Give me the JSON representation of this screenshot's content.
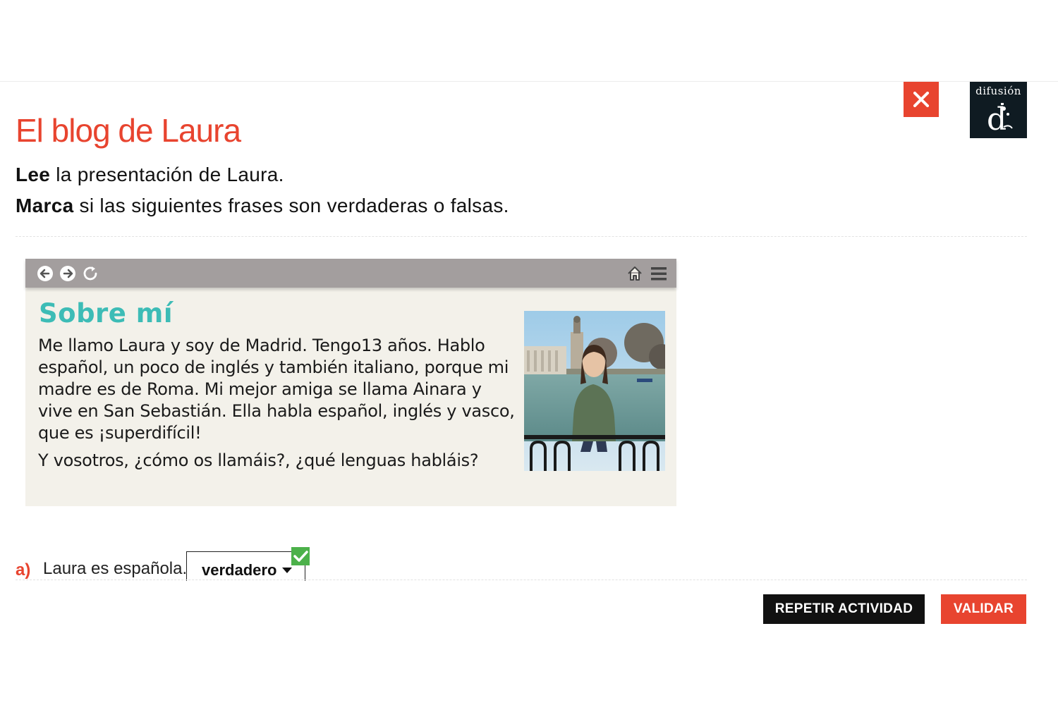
{
  "header": {
    "logo_text": "difusión",
    "logo_mark": "d"
  },
  "activity": {
    "title": "El blog de Laura",
    "instruction_1_bold": "Lee",
    "instruction_1_rest": " la presentación de Laura.",
    "instruction_2_bold": "Marca",
    "instruction_2_rest": " si las siguientes frases son verdaderas o falsas."
  },
  "blog": {
    "heading": "Sobre mí",
    "paragraph": "Me llamo Laura y soy de Madrid. Tengo13 años. Hablo español, un poco de inglés y también italiano, porque mi madre es de Roma. Mi mejor amiga se llama Ainara y vive en San Sebastián. Ella habla español, inglés y vasco, que es ¡superdifícil!",
    "question": "Y vosotros, ¿cómo os llamáis?, ¿qué lenguas habláis?"
  },
  "questions": [
    {
      "letter": "a)",
      "text": "Laura es española.",
      "selected": "verdadero"
    }
  ],
  "buttons": {
    "repeat": "REPETIR ACTIVIDAD",
    "validate": "VALIDAR"
  },
  "colors": {
    "accent": "#e8442f",
    "heading_teal": "#3dbcb6",
    "correct_green": "#4cb14a"
  },
  "icons": [
    "close-icon",
    "back-arrow-icon",
    "forward-arrow-icon",
    "reload-icon",
    "home-icon",
    "menu-icon",
    "dropdown-arrow-icon",
    "check-icon"
  ]
}
